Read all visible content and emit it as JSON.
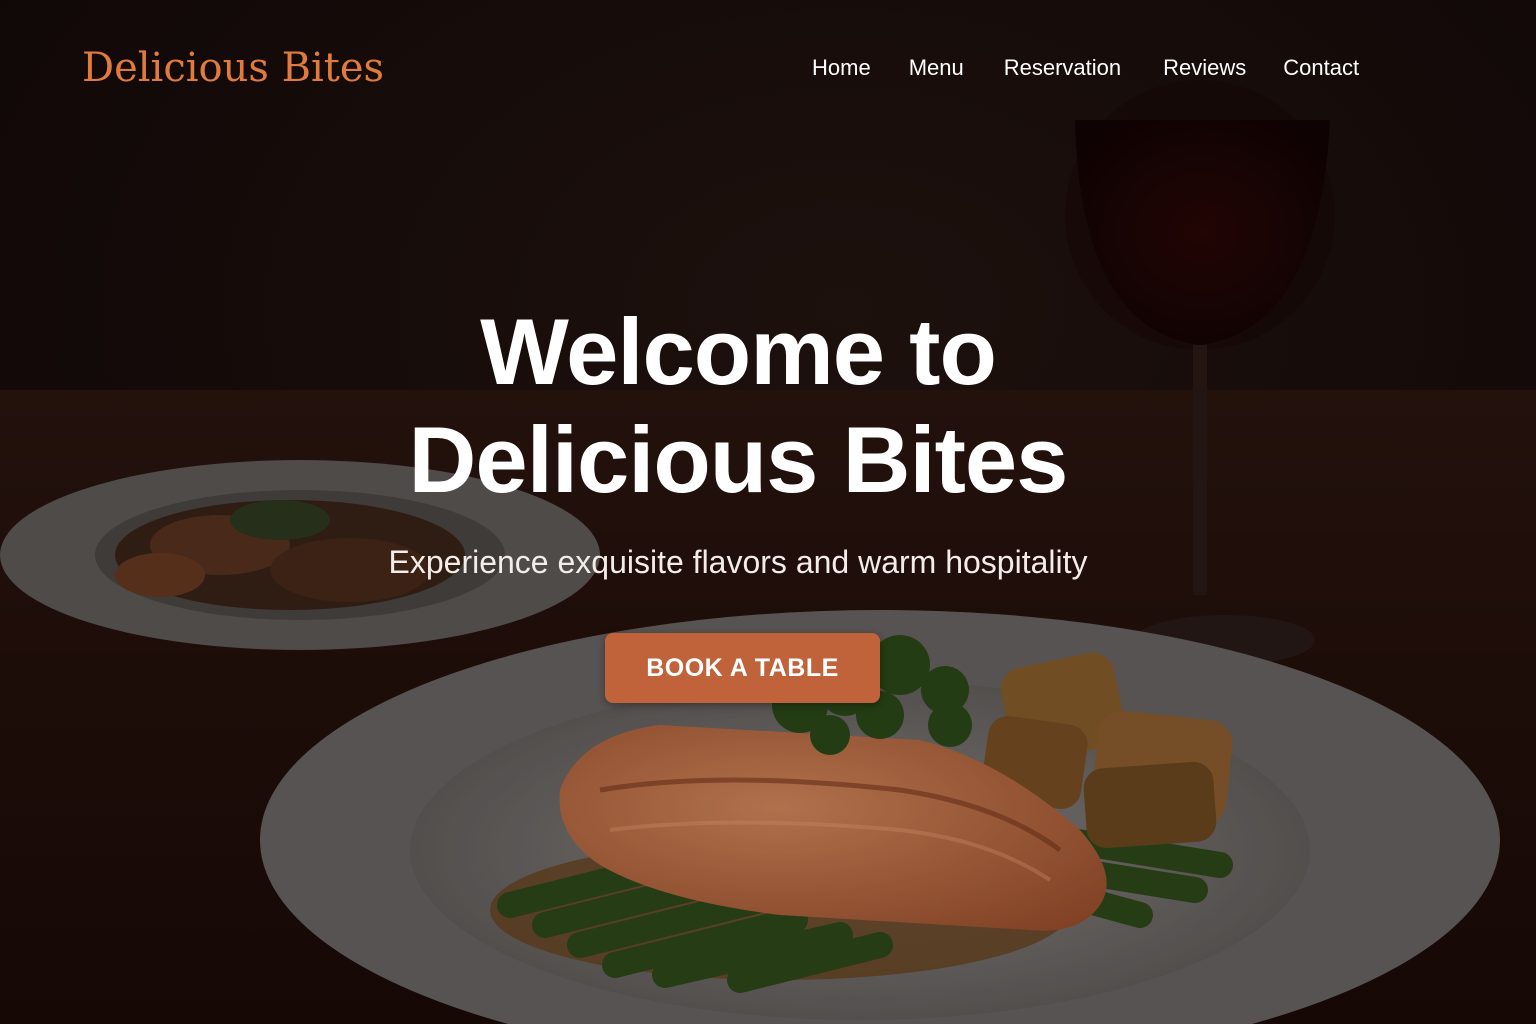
{
  "brand": {
    "name": "Delicious Bites",
    "color": "#e07b3d"
  },
  "nav": {
    "items": [
      {
        "label": "Home"
      },
      {
        "label": "Menu"
      },
      {
        "label": "Reservation"
      },
      {
        "label": "Reviews"
      },
      {
        "label": "Contact"
      }
    ]
  },
  "hero": {
    "title_line_1": "Welcome to",
    "title_line_2": "Delicious Bites",
    "subtitle": "Experience exquisite flavors and warm hospitality",
    "cta_label": "BOOK A TABLE",
    "cta_color": "#c0623a",
    "background": "dimmed photo of salmon with asparagus and roasted potatoes on a white plate, side dish plate, glass of red wine"
  }
}
